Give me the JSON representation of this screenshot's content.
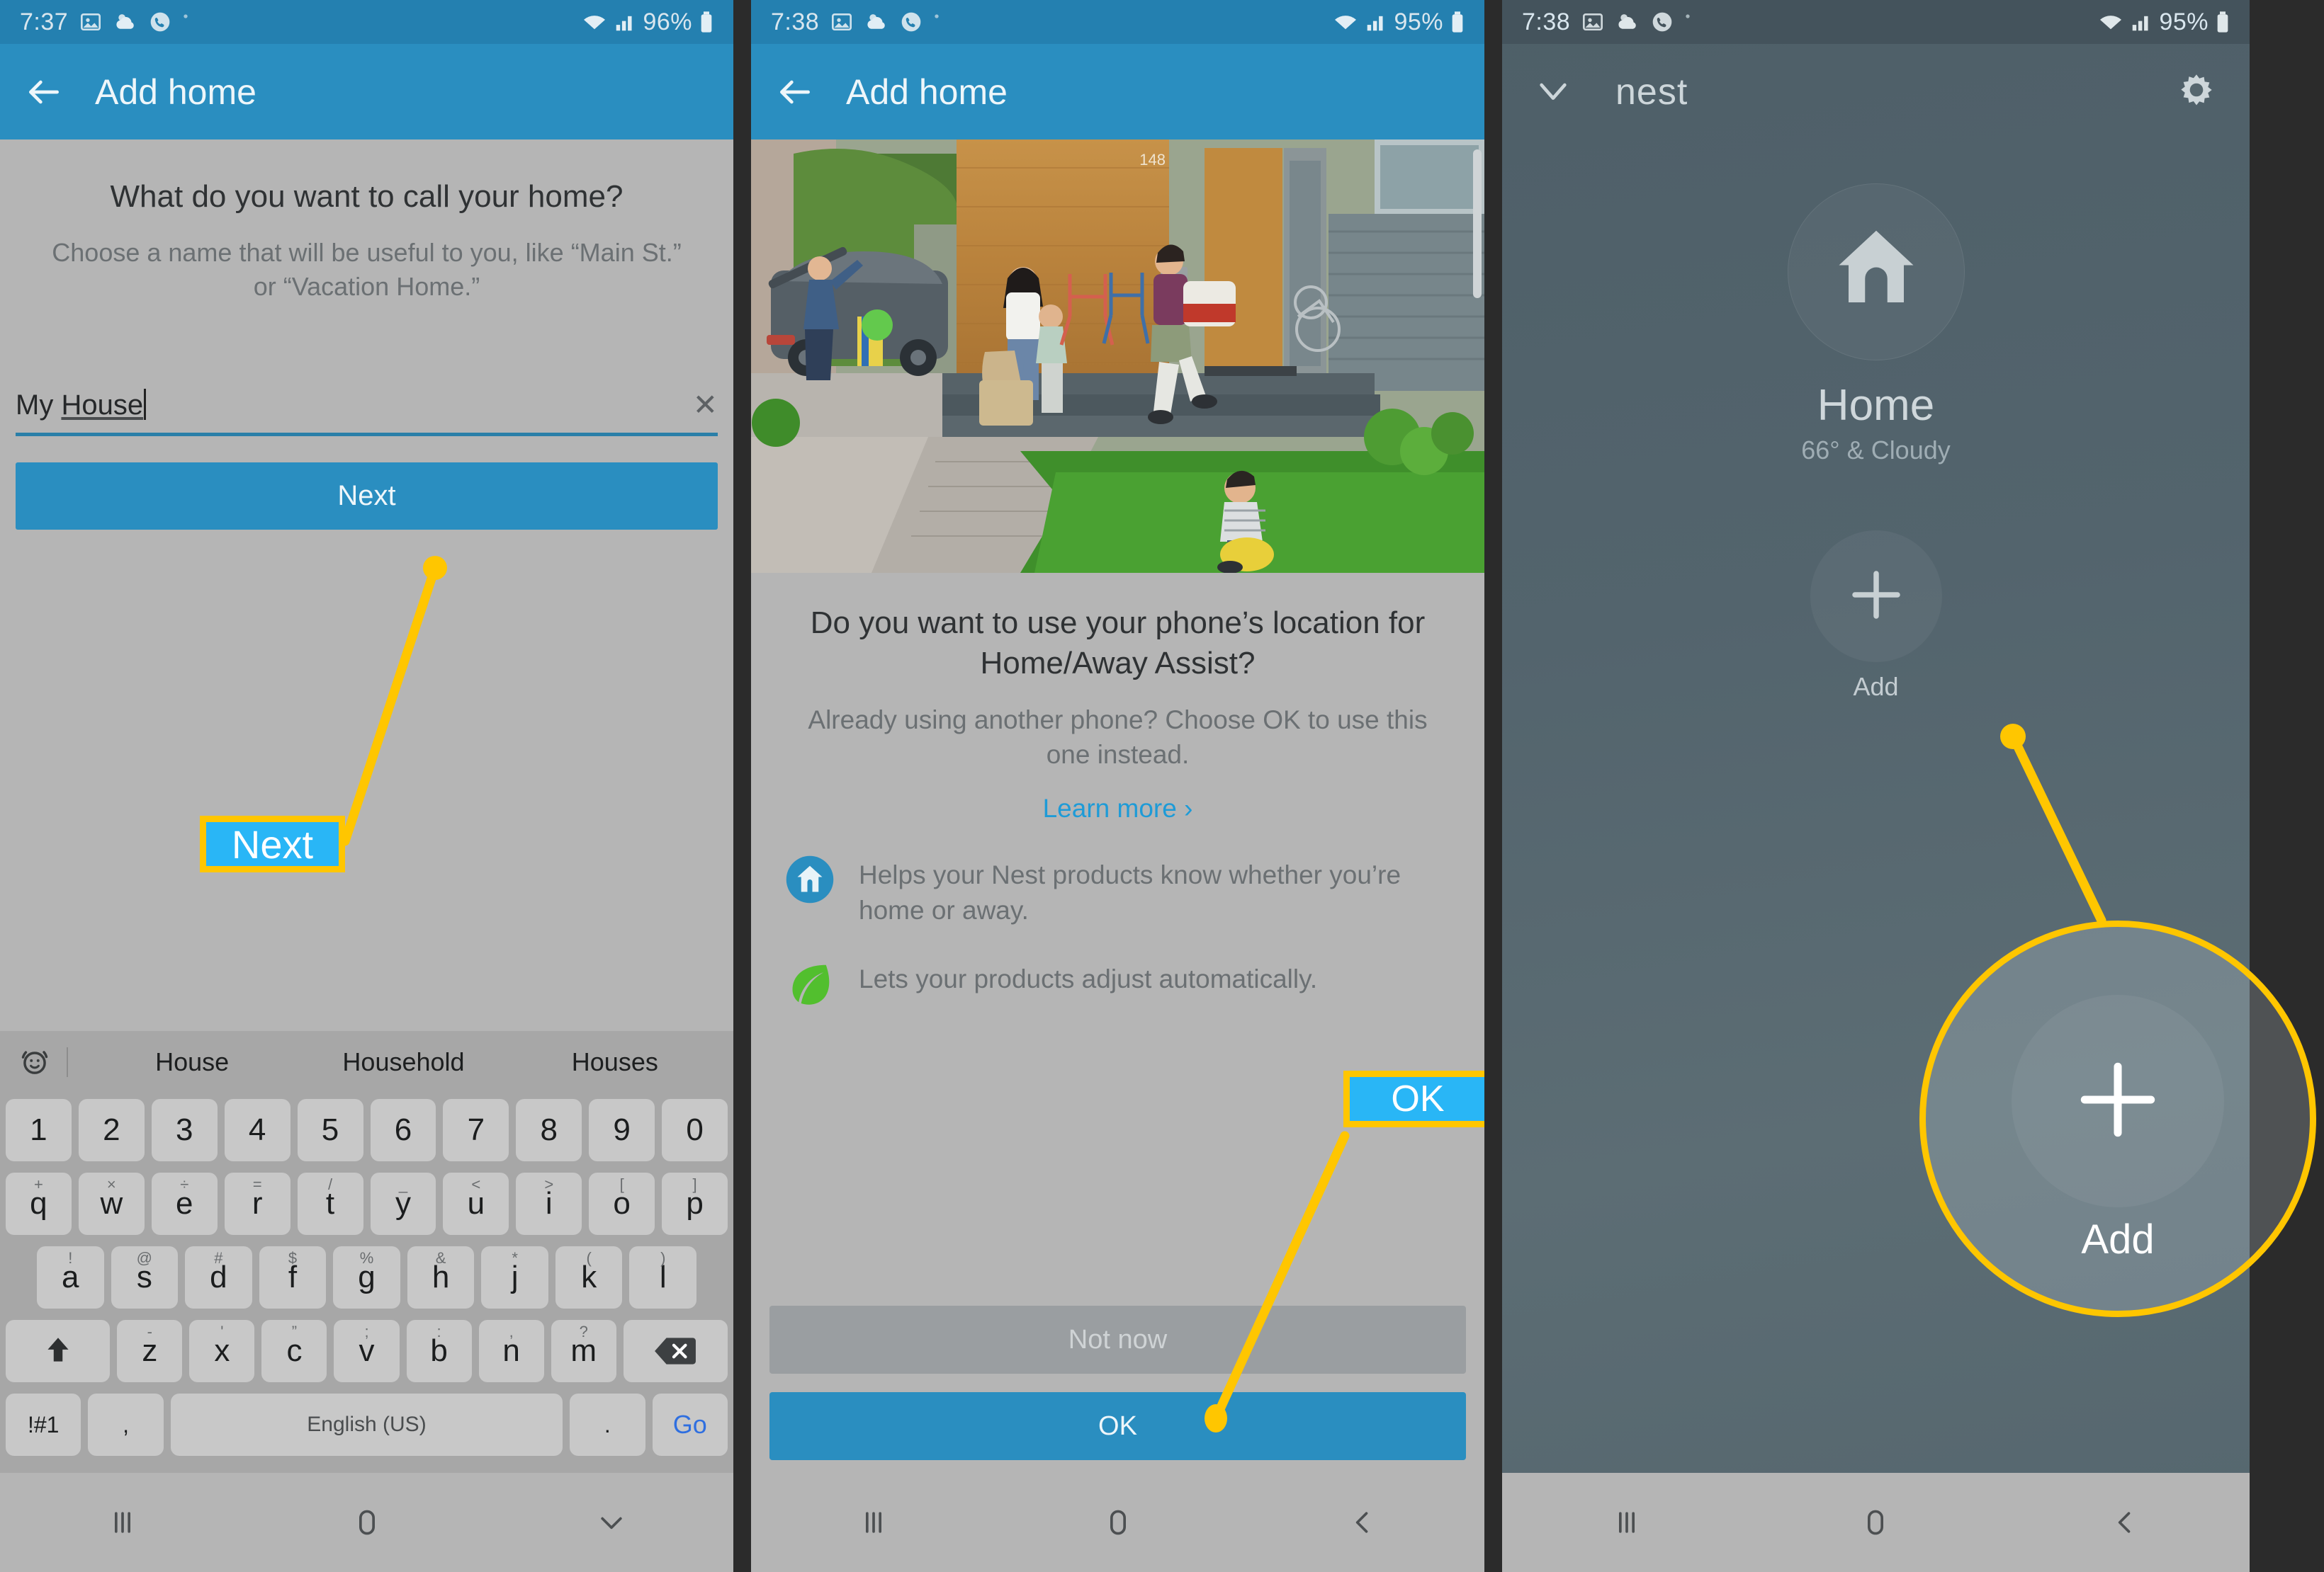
{
  "panel1": {
    "status": {
      "time": "7:37",
      "battery": "96%",
      "icons": [
        "image-icon",
        "weather-icon",
        "phone-icon",
        "wifi-icon",
        "signal-icon",
        "battery-icon"
      ]
    },
    "appbar": {
      "title": "Add home",
      "back_icon": "back-arrow-icon"
    },
    "question": "What do you want to call your home?",
    "subtitle": "Choose a name that will be useful to you, like “Main St.” or “Vacation Home.”",
    "field": {
      "value_plain": "My ",
      "value_spell": "House",
      "clear_icon": "close-icon"
    },
    "next_label": "Next",
    "keyboard": {
      "suggestion_icon": "emoji-icon",
      "suggestions": [
        "House",
        "Household",
        "Houses"
      ],
      "row_numbers": [
        "1",
        "2",
        "3",
        "4",
        "5",
        "6",
        "7",
        "8",
        "9",
        "0"
      ],
      "row_top": [
        {
          "k": "q",
          "alt": "+"
        },
        {
          "k": "w",
          "alt": "×"
        },
        {
          "k": "e",
          "alt": "÷"
        },
        {
          "k": "r",
          "alt": "="
        },
        {
          "k": "t",
          "alt": "/"
        },
        {
          "k": "y",
          "alt": "_"
        },
        {
          "k": "u",
          "alt": "<"
        },
        {
          "k": "i",
          "alt": ">"
        },
        {
          "k": "o",
          "alt": "["
        },
        {
          "k": "p",
          "alt": "]"
        }
      ],
      "row_home": [
        {
          "k": "a",
          "alt": "!"
        },
        {
          "k": "s",
          "alt": "@"
        },
        {
          "k": "d",
          "alt": "#"
        },
        {
          "k": "f",
          "alt": "$"
        },
        {
          "k": "g",
          "alt": "%"
        },
        {
          "k": "h",
          "alt": "&"
        },
        {
          "k": "j",
          "alt": "*"
        },
        {
          "k": "k",
          "alt": "("
        },
        {
          "k": "l",
          "alt": ")"
        }
      ],
      "row_bottom": [
        {
          "k": "z",
          "alt": "-"
        },
        {
          "k": "x",
          "alt": "'"
        },
        {
          "k": "c",
          "alt": "”"
        },
        {
          "k": "v",
          "alt": ";"
        },
        {
          "k": "b",
          "alt": ":"
        },
        {
          "k": "n",
          "alt": ","
        },
        {
          "k": "m",
          "alt": "?"
        }
      ],
      "shift_icon": "shift-arrow-icon",
      "backspace_icon": "backspace-icon",
      "symbols_label": "!#1",
      "comma_label": ",",
      "space_label": "English (US)",
      "period_label": ".",
      "go_label": "Go"
    },
    "navbar": [
      "recents-icon",
      "home-icon",
      "hide-keyboard-icon"
    ],
    "callout": {
      "label": "Next"
    }
  },
  "panel2": {
    "status": {
      "time": "7:38",
      "battery": "95%"
    },
    "appbar": {
      "title": "Add home",
      "back_icon": "back-arrow-icon"
    },
    "hero_alt": "family-arriving-home-photo",
    "house_number": "148",
    "title": "Do you want to use your phone’s location for Home/Away Assist?",
    "subtitle": "Already using another phone? Choose OK to use this one instead.",
    "link": "Learn more ›",
    "features": [
      {
        "icon": "home-badge-icon",
        "text": "Helps your Nest products know whether you’re home or away."
      },
      {
        "icon": "leaf-icon",
        "text": "Lets your products adjust automatically."
      }
    ],
    "not_now_label": "Not now",
    "ok_label": "OK",
    "navbar": [
      "recents-icon",
      "home-icon",
      "back-icon"
    ],
    "callout": {
      "label": "OK"
    }
  },
  "panel3": {
    "status": {
      "time": "7:38",
      "battery": "95%"
    },
    "appbar": {
      "chevron_icon": "chevron-down-icon",
      "logo": "nest",
      "gear_icon": "gear-icon"
    },
    "home_icon": "nest-house-icon",
    "home_name": "Home",
    "weather": "66° & Cloudy",
    "add_icon": "plus-icon",
    "add_label": "Add",
    "navbar": [
      "recents-icon",
      "home-icon",
      "back-icon"
    ],
    "callout": {
      "label": "Add",
      "icon": "plus-icon"
    }
  },
  "colors": {
    "appbar_blue": "#2a8ec0",
    "statusbar_blue": "#2480b0",
    "panel_grey": "#b5b5b5",
    "callout_fill": "#29b6f6",
    "callout_border": "#ffc600",
    "link_blue": "#1e9bd7",
    "nest_bg": "#53646d"
  }
}
